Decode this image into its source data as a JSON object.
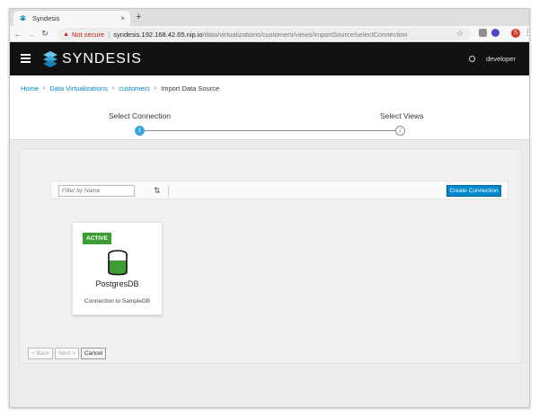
{
  "browser": {
    "tab_title": "Syndesis",
    "tab_close": "×",
    "new_tab": "+",
    "security_label": "Not secure",
    "url_separator": "|",
    "url_host": "syndesis.192.168.42.65.nip.io",
    "url_path": "/data/virtualizations/customers/views/importSource/selectConnection",
    "profile_initial": "S"
  },
  "app": {
    "brand": "SYNDESIS",
    "username": "developer",
    "header_bg": "#111111"
  },
  "breadcrumb": {
    "items": [
      "Home",
      "Data Virtualizations",
      "customers",
      "Import Data Source"
    ]
  },
  "wizard": {
    "steps": [
      {
        "label": "Select Connection",
        "number": "1",
        "active": true
      },
      {
        "label": "Select Views",
        "number": "2",
        "active": false
      }
    ]
  },
  "toolbar": {
    "filter_placeholder": "Filter by Name",
    "create_label": "Create Connection",
    "accent_color": "#0088ce"
  },
  "connection_card": {
    "status": "ACTIVE",
    "status_color": "#3f9c35",
    "name": "PostgresDB",
    "description": "Connection to SampleDB",
    "icon": "database-icon"
  },
  "footer": {
    "back_label": "< Back",
    "next_label": "Next >",
    "cancel_label": "Cancel"
  }
}
